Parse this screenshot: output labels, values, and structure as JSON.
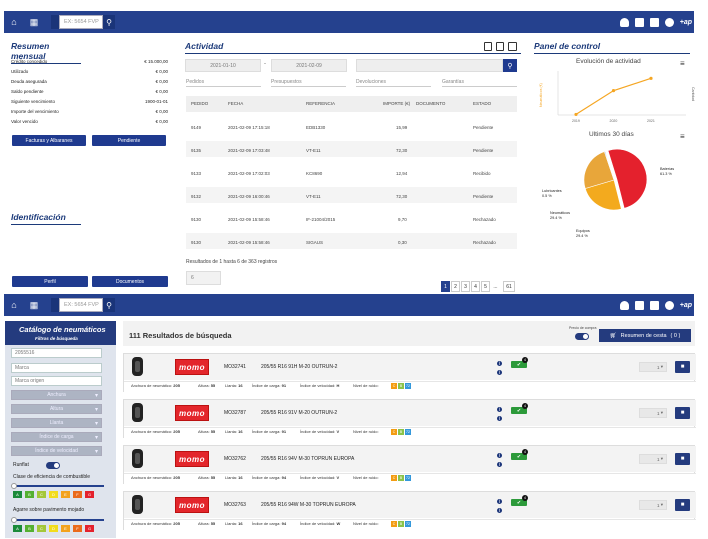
{
  "topbar": {
    "search_placeholder": "EX: 5654 FVP",
    "right_label": "+ap"
  },
  "resumen": {
    "title": "Resumen mensual",
    "rows": [
      {
        "label": "Crédito concedido",
        "value": "€ 15.000,00"
      },
      {
        "label": "Utilizado",
        "value": "€ 0,00"
      },
      {
        "label": "Deuda asegurada",
        "value": "€ 0,00"
      },
      {
        "label": "Saldo pendiente",
        "value": "€ 0,00"
      },
      {
        "label": "Siguiente vencimiento",
        "value": "1900-01-01"
      },
      {
        "label": "Importe del vencimiento",
        "value": "€ 0,00"
      },
      {
        "label": "Valor vencido",
        "value": "€ 0,00"
      }
    ],
    "btn_facturas": "Facturas y Albaranes",
    "btn_pendiente": "Pendiente"
  },
  "identificacion": {
    "title": "Identificación",
    "btn_perfil": "Perfil",
    "btn_documentos": "Documentos"
  },
  "actividad": {
    "title": "Actividad",
    "date_from": "2021-01-10",
    "date_sep": "-",
    "date_to": "2021-02-09",
    "tabs": [
      "Pedidos",
      "Presupuestos",
      "Devoluciones",
      "Garantías"
    ],
    "columns": [
      "PEDIDO",
      "FECHA",
      "REFERENCIA",
      "IMPORTE (€)",
      "DOCUMENTO",
      "ESTADO"
    ],
    "rows": [
      {
        "pedido": "9149",
        "fecha": "2021-02-09 17:15:18",
        "ref": "EDB1330",
        "importe": "15,99",
        "estado": "Pendiente"
      },
      {
        "pedido": "9135",
        "fecha": "2021-02-09 17:03:48",
        "ref": "VT-E11",
        "importe": "72,30",
        "estado": "Pendiente"
      },
      {
        "pedido": "9133",
        "fecha": "2021-02-09 17:02:03",
        "ref": "KC8690",
        "importe": "12,94",
        "estado": "Recibido"
      },
      {
        "pedido": "9132",
        "fecha": "2021-02-09 16:00:46",
        "ref": "VT-E11",
        "importe": "72,30",
        "estado": "Pendiente"
      },
      {
        "pedido": "9130",
        "fecha": "2021-02-09 15:58:46",
        "ref": "IF-21004/2015",
        "importe": "9,70",
        "estado": "Rechazado"
      },
      {
        "pedido": "9130",
        "fecha": "2021-02-09 15:58:46",
        "ref": "SIGAUS",
        "importe": "0,30",
        "estado": "Rechazado"
      }
    ],
    "results_text": "Resultados de 1 hasta 6 de 363 registros",
    "page_size": "6",
    "pages": [
      "1",
      "2",
      "3",
      "4",
      "5",
      "...",
      "61"
    ]
  },
  "panel_control": {
    "title": "Panel de control",
    "line_title": "Evolución de actividad",
    "pie_title": "Ultimos 30 días"
  },
  "chart_data": [
    {
      "type": "line",
      "title": "Evolución de actividad",
      "x": [
        "2019",
        "2020",
        "2021"
      ],
      "series": [
        {
          "name": "Neumáticos (€)",
          "values": [
            0.2,
            8.3,
            12.5
          ]
        }
      ],
      "ylim": [
        0,
        15
      ],
      "legend": "none",
      "grid": false
    },
    {
      "type": "pie",
      "title": "Ultimos 30 días",
      "categories": [
        "Baterías",
        "Equipos",
        "Neumáticos",
        "Lubricantes"
      ],
      "values": [
        61.3,
        29.4,
        29.4,
        0.5
      ],
      "labels": [
        "Baterías\n61.3 %",
        "Equipos\n29.4 %",
        "Neumáticos\n29.4 %",
        "Lubricantes\n0.5 %"
      ],
      "colors": [
        "#e4212d",
        "#f3aa1e",
        "#e8a63a",
        "#2b56a8"
      ]
    }
  ],
  "catalogo": {
    "title": "Catálogo de neumáticos",
    "subtitle": "Filtros de búsqueda",
    "search_value": "2055516",
    "marca_placeholder": "Marca",
    "marca_origen_placeholder": "Marca origen",
    "selects": [
      "Anchura",
      "Altura",
      "Llanta",
      "Índice de carga",
      "Índice de velocidad"
    ],
    "runflat": "Runflat",
    "clase_label": "Clase de eficiencia de combustible",
    "clase_letters": [
      "A",
      "B",
      "C",
      "D",
      "E",
      "F",
      "G"
    ],
    "agarre_label": "Agarre sobre pavimento mojado",
    "agarre_letters": [
      "A",
      "B",
      "C",
      "D",
      "E",
      "F",
      "G"
    ]
  },
  "resultados": {
    "title": "111 Resultados de búsqueda",
    "toggle_label": "Precio de compra",
    "cart_label": "Resumen de cesta",
    "cart_count": "( 0 )",
    "items": [
      {
        "brand": "momo",
        "code": "MO32741",
        "desc": "205/55 R16 91H M-20 OUTRUN-2",
        "stock": "✔",
        "stock_count": "4",
        "qty": "1",
        "anchura": "205",
        "altura": "55",
        "llanta": "16",
        "carga": "91",
        "velocidad": "H",
        "badges": [
          "C",
          "B",
          "72"
        ]
      },
      {
        "brand": "momo",
        "code": "MO32787",
        "desc": "205/55 R16 91V M-20 OUTRUN-2",
        "stock": "✔",
        "stock_count": "4",
        "qty": "1",
        "anchura": "205",
        "altura": "55",
        "llanta": "16",
        "carga": "91",
        "velocidad": "V",
        "badges": [
          "C",
          "B",
          "72"
        ]
      },
      {
        "brand": "momo",
        "code": "MO32762",
        "desc": "205/55 R16 94V M-30 TOPRUN EUROPA",
        "stock": "✔",
        "stock_count": "4",
        "qty": "1",
        "anchura": "205",
        "altura": "55",
        "llanta": "16",
        "carga": "94",
        "velocidad": "V",
        "badges": [
          "C",
          "B",
          "72"
        ]
      },
      {
        "brand": "momo",
        "code": "MO32763",
        "desc": "205/55 R16 94W M-30 TOPRUN EUROPA",
        "stock": "✔",
        "stock_count": "4",
        "qty": "1",
        "anchura": "205",
        "altura": "55",
        "llanta": "16",
        "carga": "94",
        "velocidad": "W",
        "badges": [
          "C",
          "B",
          "72"
        ]
      }
    ],
    "spec_labels": {
      "anchura": "Anchura de neumático:",
      "altura": "Altura:",
      "llanta": "Llanta:",
      "carga": "Índice de carga:",
      "velocidad": "Índice de velocidad:",
      "ruido": "Nivel de ruido:"
    }
  },
  "colors": {
    "brand_blue": "#25418e",
    "momo_red": "#e3262b",
    "stock_green": "#2c9a3a"
  }
}
